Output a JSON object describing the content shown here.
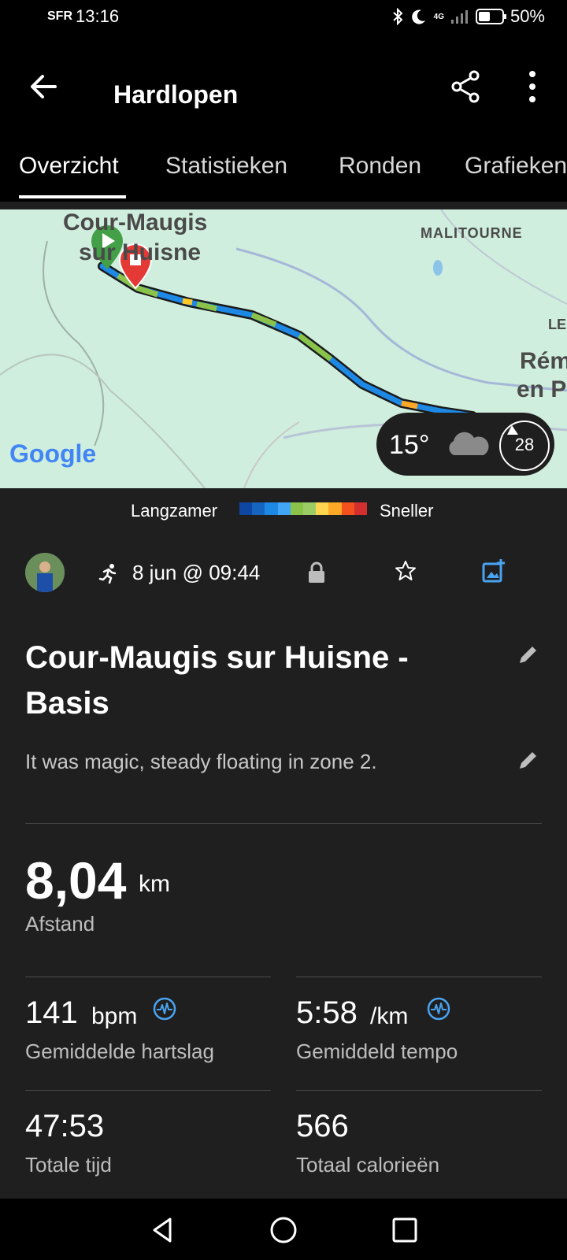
{
  "status_bar": {
    "carrier": "SFR",
    "time": "13:16",
    "network": "4G",
    "battery": "50%"
  },
  "header": {
    "title": "Hardlopen"
  },
  "tabs": [
    {
      "label": "Overzicht",
      "active": true
    },
    {
      "label": "Statistieken",
      "active": false
    },
    {
      "label": "Ronden",
      "active": false
    },
    {
      "label": "Grafieken",
      "active": false
    }
  ],
  "map": {
    "labels": {
      "town_start_line1": "Cour-Maugis",
      "town_start_line2": "sur Huisne",
      "malitourne": "MALITOURNE",
      "le": "LE",
      "remalard_line1": "Rém",
      "remalard_line2": "en P"
    },
    "google": "Google",
    "weather": {
      "temperature": "15°",
      "icon": "cloud-icon",
      "wind": "28"
    }
  },
  "legend": {
    "slower": "Langzamer",
    "faster": "Sneller",
    "colors": [
      "#0d47a1",
      "#1565c0",
      "#1e88e5",
      "#42a5f5",
      "#8bc34a",
      "#9ccc65",
      "#ffd54f",
      "#ffa726",
      "#f4511e",
      "#d32f2f"
    ]
  },
  "activity": {
    "date": "8 jun @ 09:44",
    "title": "Cour-Maugis sur Huisne - Basis",
    "description": "It was magic, steady floating in zone 2."
  },
  "stats": {
    "distance": {
      "value": "8,04",
      "unit": "km",
      "label": "Afstand"
    },
    "heart_rate": {
      "value": "141",
      "unit": "bpm",
      "label": "Gemiddelde hartslag"
    },
    "pace": {
      "value": "5:58",
      "unit": "/km",
      "label": "Gemiddeld tempo"
    },
    "total_time": {
      "value": "47:53",
      "label": "Totale tijd"
    },
    "calories": {
      "value": "566",
      "label": "Totaal calorieën"
    }
  }
}
